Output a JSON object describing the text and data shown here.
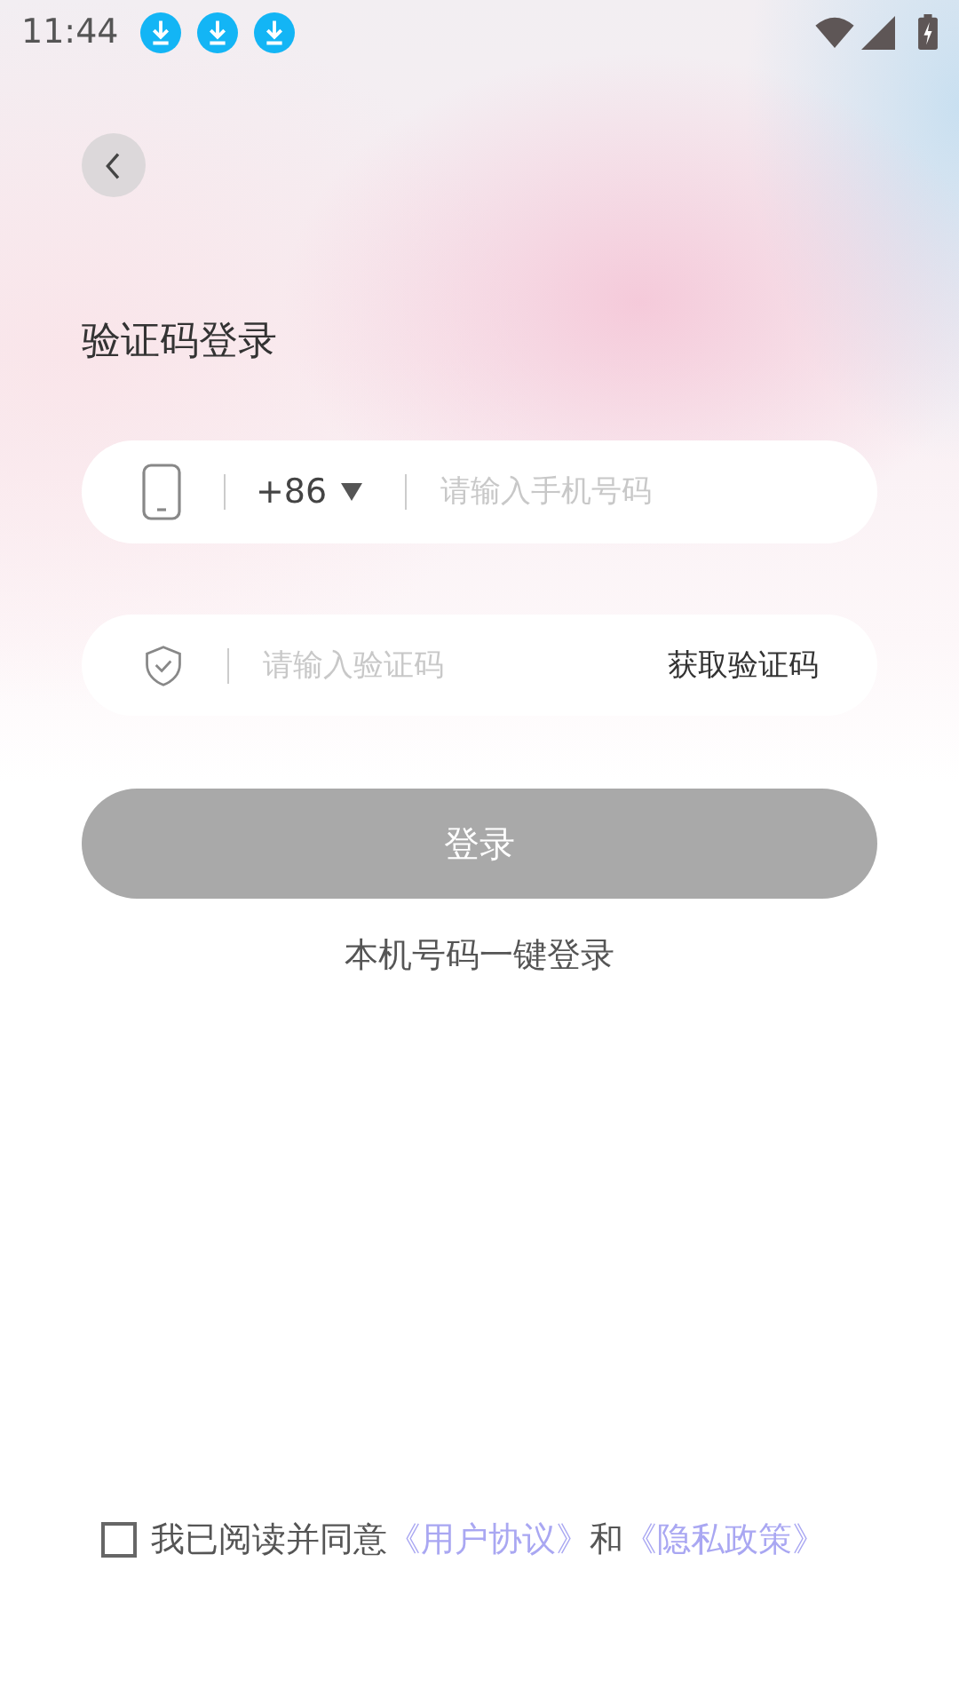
{
  "status_bar": {
    "time": "11:44",
    "notifications": [
      {
        "kind": "download"
      },
      {
        "kind": "download"
      },
      {
        "kind": "download"
      }
    ]
  },
  "title": "验证码登录",
  "phone_field": {
    "country_code": "+86",
    "placeholder": "请输入手机号码"
  },
  "code_field": {
    "placeholder": "请输入验证码",
    "action": "获取验证码"
  },
  "login_button": {
    "label": "登录",
    "disabled": true
  },
  "one_click_login": "本机号码一键登录",
  "agreement": {
    "checked": false,
    "parts": [
      {
        "kind": "text",
        "text": "我已阅读并同意"
      },
      {
        "kind": "link",
        "text": "《用户协议》"
      },
      {
        "kind": "text",
        "text": "和"
      },
      {
        "kind": "link",
        "text": "《隐私政策》"
      }
    ]
  }
}
